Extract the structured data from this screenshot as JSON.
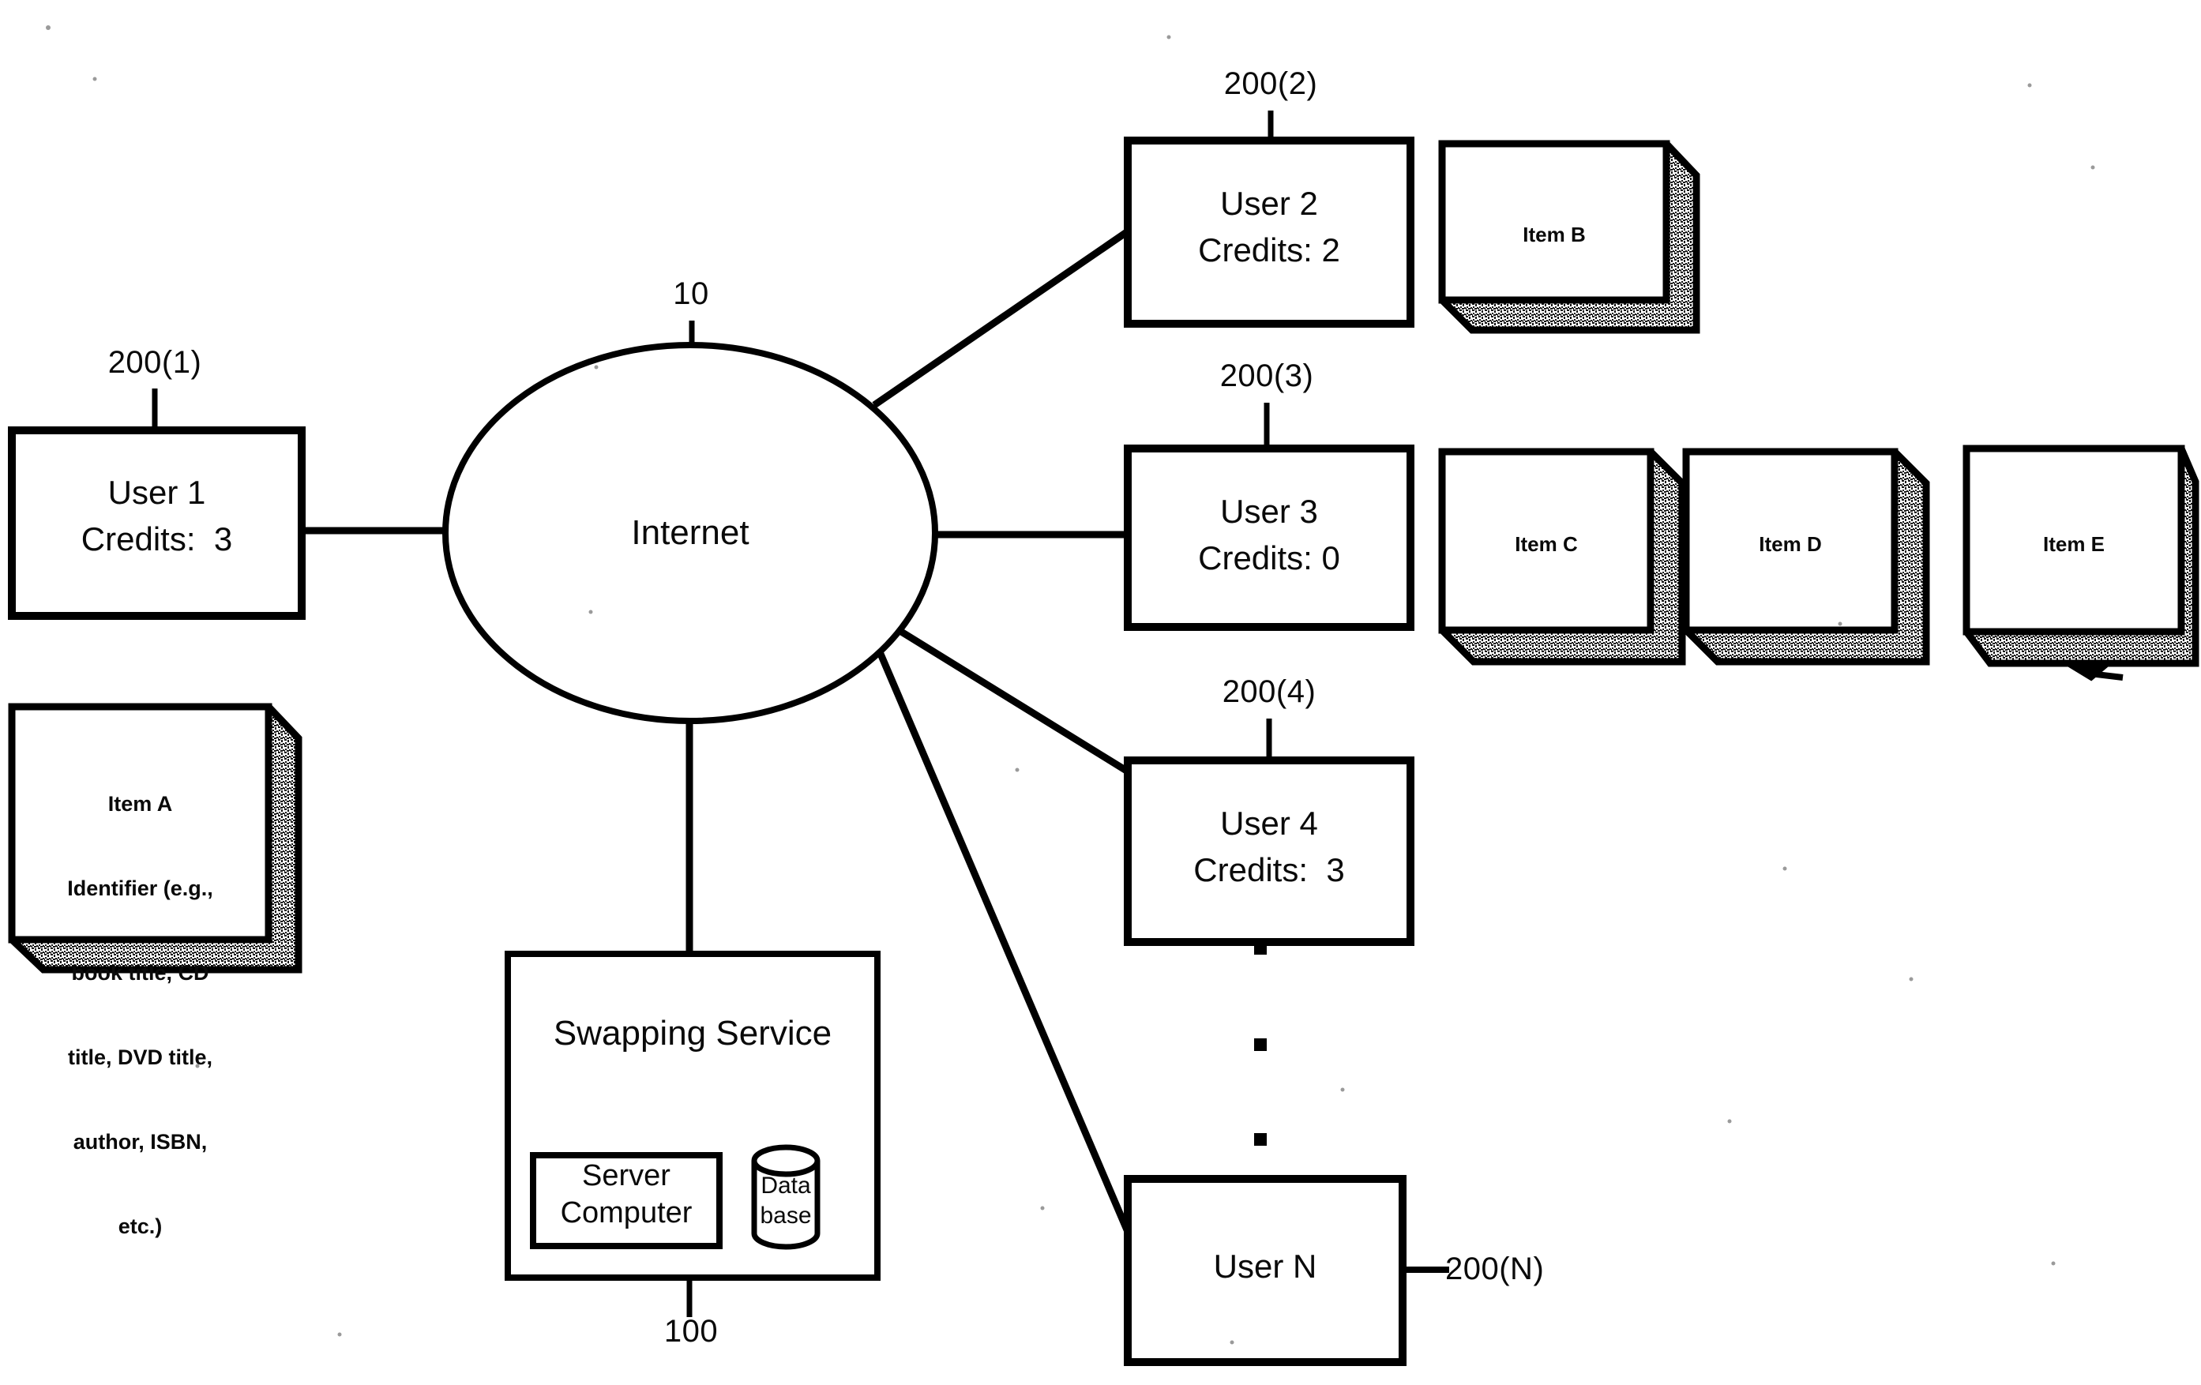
{
  "figure": {
    "type": "patent-diagram",
    "background_color": "#ffffff",
    "ink_color": "#000000"
  },
  "network": {
    "label": "Internet",
    "ref": "10"
  },
  "service": {
    "title": "Swapping Service",
    "ref": "100",
    "server": {
      "line1": "Server",
      "line2": "Computer"
    },
    "database": {
      "line1": "Data",
      "line2": "base"
    }
  },
  "users": [
    {
      "name": "User 1",
      "credits_line": "Credits:  3",
      "credits_value": "3",
      "ref": "200(1)"
    },
    {
      "name": "User 2",
      "credits_line": "Credits: 2",
      "credits_value": "2",
      "ref": "200(2)"
    },
    {
      "name": "User 3",
      "credits_line": "Credits: 0",
      "credits_value": "0",
      "ref": "200(3)"
    },
    {
      "name": "User 4",
      "credits_line": "Credits:  3",
      "credits_value": "3",
      "ref": "200(4)"
    },
    {
      "name": "User N",
      "credits_line": "",
      "credits_value": "",
      "ref": "200(N)"
    }
  ],
  "items": [
    {
      "id": "item-a",
      "lines": [
        "Item A",
        "Identifier (e.g.,",
        "book title, CD",
        "title, DVD title,",
        "author, ISBN,",
        "etc.)"
      ]
    },
    {
      "id": "item-b",
      "lines": [
        "Item B"
      ]
    },
    {
      "id": "item-c",
      "lines": [
        "Item C"
      ]
    },
    {
      "id": "item-d",
      "lines": [
        "Item D"
      ]
    },
    {
      "id": "item-e",
      "lines": [
        "Item E"
      ]
    }
  ],
  "ellipsis": {
    "dots": "three vertical square dots between User 4 and User N"
  }
}
